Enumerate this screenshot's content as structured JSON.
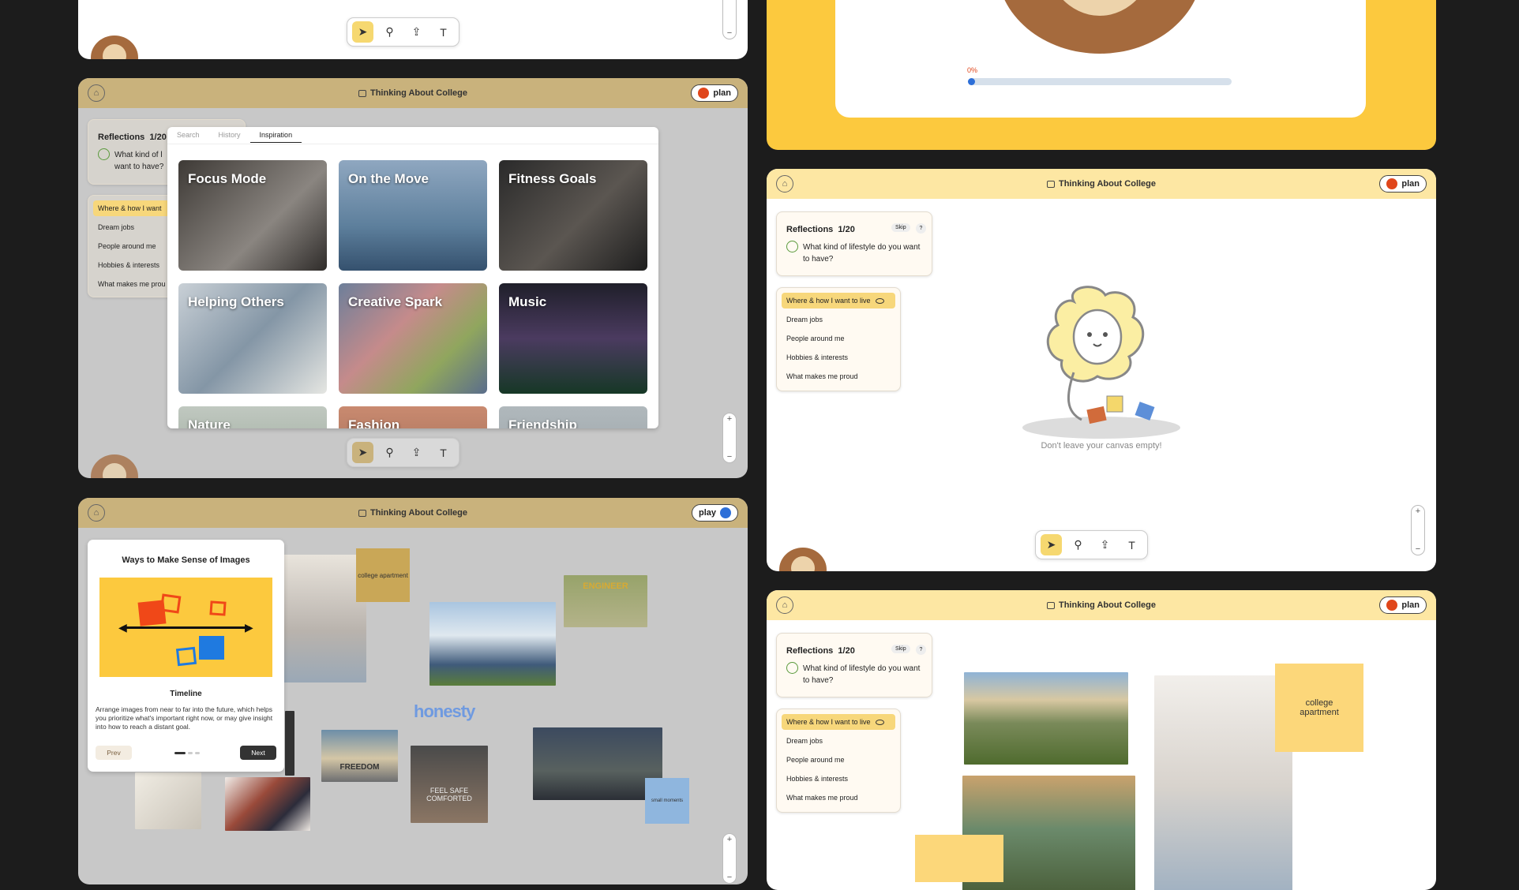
{
  "app_title": "Thinking About College",
  "modes": {
    "plan": "plan",
    "play": "play"
  },
  "colors": {
    "plan_dot": "#e0461b",
    "play_dot": "#2d6fd8",
    "header_sand": "#c9b27c",
    "header_light": "#fde7a3",
    "accent_yellow": "#fcc93e"
  },
  "toolbar": {
    "icons": [
      "pointer-icon",
      "search-icon",
      "upload-icon",
      "text-icon"
    ]
  },
  "progress": {
    "label": "0%",
    "value": 0
  },
  "reflections": {
    "title": "Reflections",
    "count": "1/20",
    "skip": "Skip",
    "help": "?",
    "question": "What kind of lifestyle do you want to have?",
    "question_short": "What kind of lifestyle do you want to have?"
  },
  "topics": [
    "Where & how I want to live",
    "Dream jobs",
    "People around me",
    "Hobbies & interests",
    "What makes me proud"
  ],
  "topics_truncated": [
    "Where & how I want",
    "Dream jobs",
    "People around me",
    "Hobbies & interests",
    "What makes me prou"
  ],
  "question_truncated_1": "What kind of l",
  "question_truncated_2": "want to have?",
  "search_tabs": [
    "Search",
    "History",
    "Inspiration"
  ],
  "inspiration": [
    "Focus Mode",
    "On the Move",
    "Fitness Goals",
    "Helping Others",
    "Creative Spark",
    "Music",
    "Nature",
    "Fashion",
    "Friendship"
  ],
  "empty_canvas": "Don't leave your canvas empty!",
  "guide": {
    "title": "Ways to Make Sense of Images",
    "subtitle": "Timeline",
    "body": "Arrange images from near to far into the future, which helps you prioritize what's important right now, or may give insight into how to reach a distant goal.",
    "prev": "Prev",
    "next": "Next"
  },
  "notes": {
    "college_apartment": "college apartment",
    "small_moments": "small moments",
    "freedom": "FREEDOM",
    "feel_safe": "FEEL SAFE COMFORTED",
    "honesty": "honesty",
    "engineer": "ENGINEER"
  }
}
